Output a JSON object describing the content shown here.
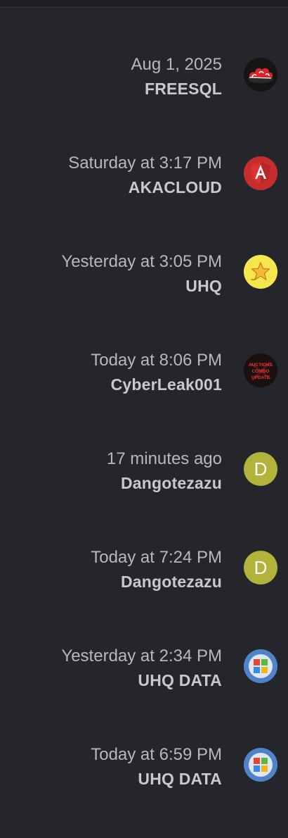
{
  "items": [
    {
      "time": "Aug 1, 2025",
      "user": "FREESQL",
      "avatar_icon": "cloud-avatar-icon"
    },
    {
      "time": "Saturday at 3:17 PM",
      "user": "AKACLOUD",
      "avatar_icon": "angular-logo-avatar-icon"
    },
    {
      "time": "Yesterday at 3:05 PM",
      "user": "UHQ",
      "avatar_icon": "star-avatar-icon"
    },
    {
      "time": "Today at 8:06 PM",
      "user": "CyberLeak001",
      "avatar_icon": "auctions-avatar-icon",
      "avatar_text": [
        "AUCTIONS",
        "COMBO",
        "UPDATE"
      ]
    },
    {
      "time": "17 minutes ago",
      "user": "Dangotezazu",
      "avatar_icon": "letter-avatar-icon",
      "avatar_letter": "D",
      "avatar_color": "#b3b33c"
    },
    {
      "time": "Today at 7:24 PM",
      "user": "Dangotezazu",
      "avatar_icon": "letter-avatar-icon",
      "avatar_letter": "D",
      "avatar_color": "#b3b33c"
    },
    {
      "time": "Yesterday at 2:34 PM",
      "user": "UHQ DATA",
      "avatar_icon": "windows-logo-avatar-icon"
    },
    {
      "time": "Today at 6:59 PM",
      "user": "UHQ DATA",
      "avatar_icon": "windows-logo-avatar-icon"
    }
  ]
}
